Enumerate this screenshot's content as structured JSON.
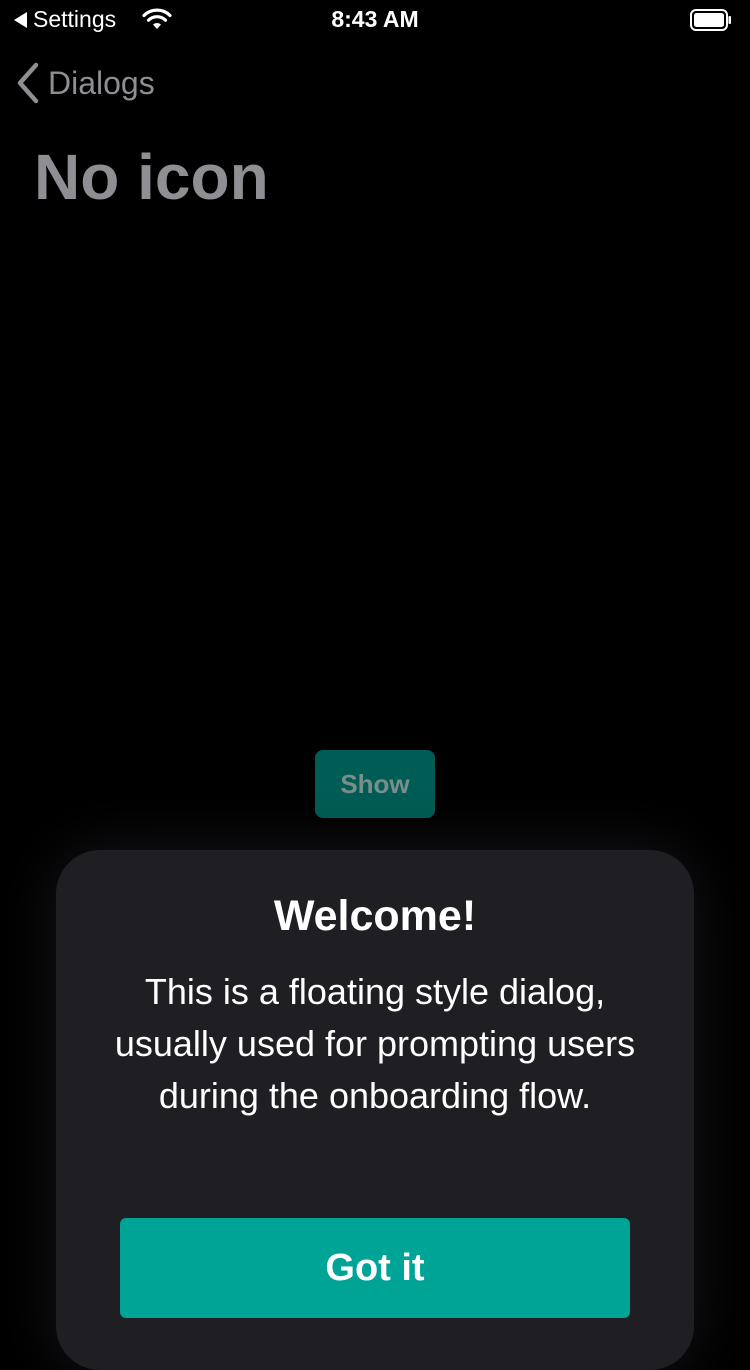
{
  "status_bar": {
    "back_label": "Settings",
    "time": "8:43 AM",
    "icons": [
      "back-triangle-icon",
      "wifi-icon",
      "battery-icon"
    ]
  },
  "nav": {
    "back_label": "Dialogs",
    "back_icon": "chevron-left-icon"
  },
  "page": {
    "title": "No icon"
  },
  "show_button": {
    "label": "Show"
  },
  "dialog": {
    "title": "Welcome!",
    "message": "This is a floating style dialog, usually used for prompting users during the onboarding flow.",
    "primary_button_label": "Got it"
  },
  "colors": {
    "background": "#000000",
    "dialog_background": "#1f1f23",
    "accent": "#00a496",
    "accent_dimmed": "#005d55",
    "muted_text": "#8e8e93"
  }
}
